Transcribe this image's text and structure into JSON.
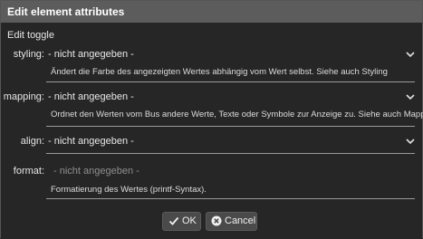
{
  "dialog": {
    "title": "Edit element attributes"
  },
  "section": {
    "title": "Edit toggle"
  },
  "fields": {
    "styling": {
      "label": "styling:",
      "value": "- nicht angegeben -",
      "hint": "Ändert die Farbe des angezeigten Wertes abhängig vom Wert selbst. Siehe auch Styling"
    },
    "mapping": {
      "label": "mapping:",
      "value": "- nicht angegeben -",
      "hint": "Ordnet den Werten vom Bus andere Werte, Texte oder Symbole zur Anzeige zu. Siehe auch Mapping"
    },
    "align": {
      "label": "align:",
      "value": "- nicht angegeben -"
    },
    "format": {
      "label": "format:",
      "placeholder": "- nicht angegeben -",
      "hint": "Formatierung des Wertes (printf-Syntax)."
    }
  },
  "buttons": {
    "ok": "OK",
    "cancel": "Cancel"
  },
  "icons": {
    "ok": "check-icon",
    "cancel": "cancel-circle-icon",
    "dropdown": "chevron-down-icon"
  },
  "colors": {
    "titlebar": "#5c5c5c",
    "background": "#262626",
    "button": "#4a4a4a"
  }
}
